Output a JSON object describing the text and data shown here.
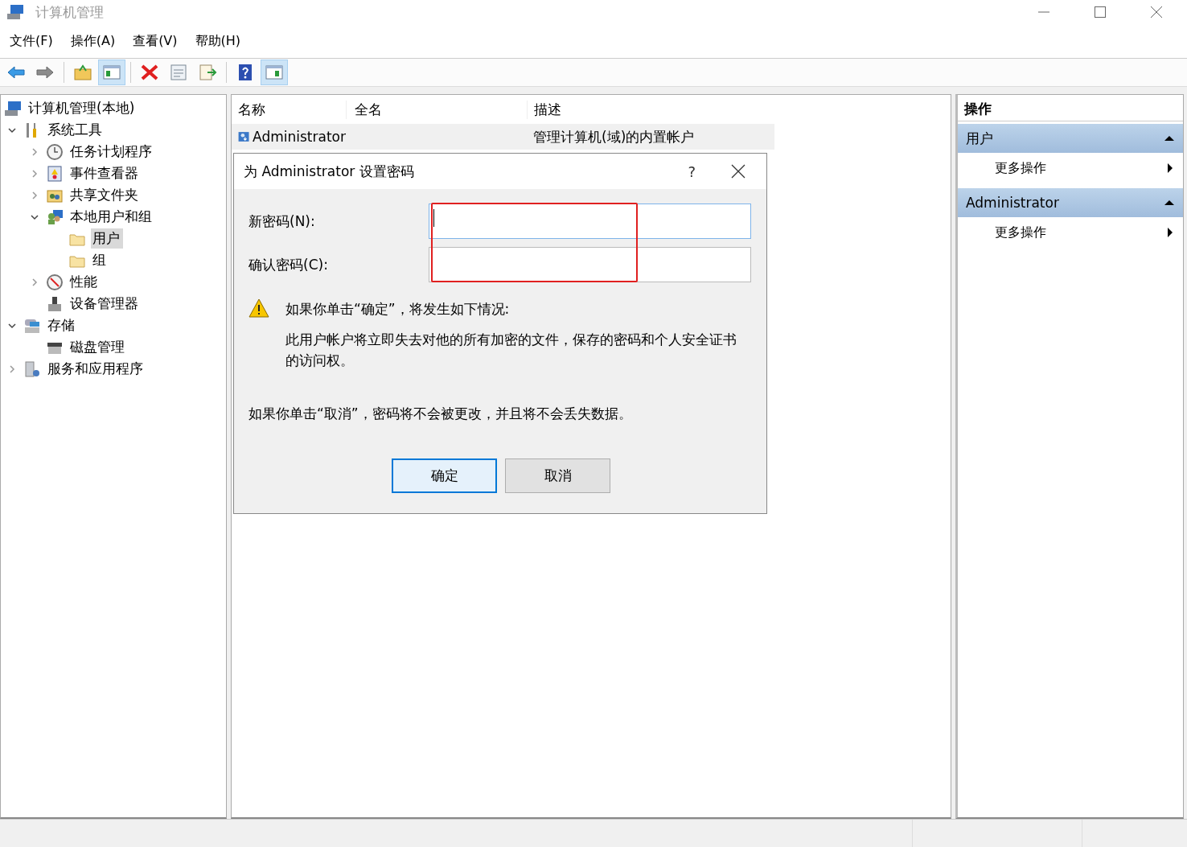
{
  "window": {
    "title": "计算机管理"
  },
  "menu": [
    "文件(F)",
    "操作(A)",
    "查看(V)",
    "帮助(H)"
  ],
  "toolbar": [
    {
      "kind": "back",
      "pressed": false
    },
    {
      "kind": "forward",
      "pressed": false
    },
    {
      "kind": "sep"
    },
    {
      "kind": "up",
      "pressed": false
    },
    {
      "kind": "tree",
      "pressed": true
    },
    {
      "kind": "sep"
    },
    {
      "kind": "delete",
      "pressed": false
    },
    {
      "kind": "properties",
      "pressed": false
    },
    {
      "kind": "export",
      "pressed": false
    },
    {
      "kind": "sep"
    },
    {
      "kind": "help",
      "pressed": false
    },
    {
      "kind": "pane",
      "pressed": true
    }
  ],
  "tree": {
    "root": {
      "label": "计算机管理(本地)",
      "kind": "computer"
    },
    "items": [
      {
        "label": "系统工具",
        "kind": "tools",
        "expanded": true,
        "selected": false,
        "children": [
          {
            "label": "任务计划程序",
            "kind": "clock",
            "expanded": false,
            "selected": false
          },
          {
            "label": "事件查看器",
            "kind": "event",
            "expanded": false,
            "selected": false
          },
          {
            "label": "共享文件夹",
            "kind": "share",
            "expanded": false,
            "selected": false
          },
          {
            "label": "本地用户和组",
            "kind": "users",
            "expanded": true,
            "selected": false,
            "children": [
              {
                "label": "用户",
                "kind": "folder",
                "selected": true
              },
              {
                "label": "组",
                "kind": "folder",
                "selected": false
              }
            ]
          },
          {
            "label": "性能",
            "kind": "perf",
            "expanded": false,
            "selected": false
          },
          {
            "label": "设备管理器",
            "kind": "device",
            "selected": false
          }
        ]
      },
      {
        "label": "存储",
        "kind": "storage",
        "expanded": true,
        "selected": false,
        "children": [
          {
            "label": "磁盘管理",
            "kind": "disk",
            "selected": false
          }
        ]
      },
      {
        "label": "服务和应用程序",
        "kind": "services",
        "expanded": false,
        "selected": false
      }
    ]
  },
  "table": {
    "columns": [
      "名称",
      "全名",
      "描述"
    ],
    "rows": [
      {
        "name": "Administrator",
        "description": "管理计算机(域)的内置帐户",
        "selected": true
      }
    ]
  },
  "dialog": {
    "title": "为 Administrator 设置密码",
    "help": "?",
    "fields": [
      {
        "label": "新密码(N):",
        "focused": true
      },
      {
        "label": "确认密码(C):",
        "focused": false
      }
    ],
    "warning": "如果你单击“确定”，将发生如下情况:",
    "warning_detail": "此用户帐户将立即失去对他的所有加密的文件，保存的密码和个人安全证书的访问权。",
    "cancel_note": "如果你单击“取消”，密码将不会被更改，并且将不会丢失数据。",
    "buttons": [
      {
        "label": "确定",
        "default": true
      },
      {
        "label": "取消",
        "default": false
      }
    ]
  },
  "actions": {
    "title": "操作",
    "sections": [
      {
        "title": "用户",
        "expanded": true,
        "items": [
          "更多操作"
        ]
      },
      {
        "title": "Administrator",
        "expanded": true,
        "items": [
          "更多操作"
        ]
      }
    ]
  }
}
